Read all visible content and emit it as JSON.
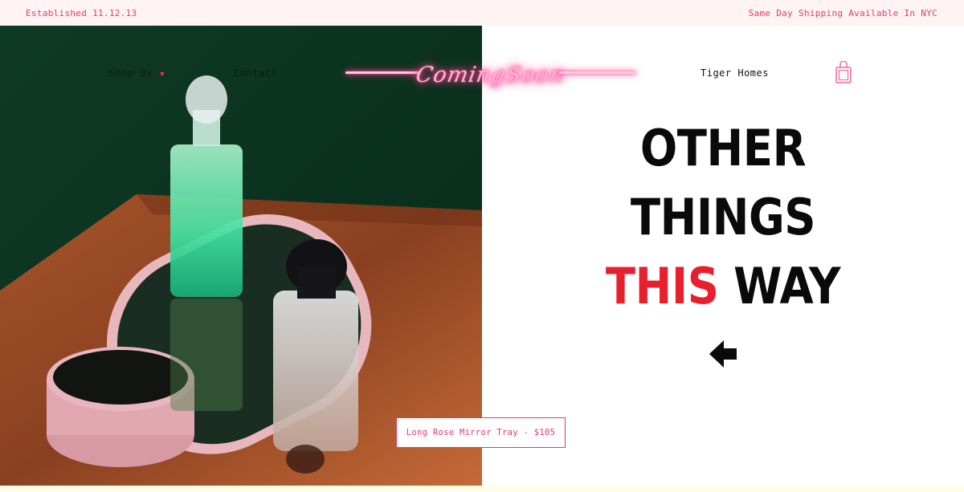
{
  "topbar": {
    "established": "Established 11.12.13",
    "shipping": "Same Day Shipping Available In NYC"
  },
  "nav": {
    "shop_by": "Shop By",
    "shop_caret_icon": "caret-down-icon",
    "contact": "Contact",
    "tiger_homes": "Tiger Homes",
    "bag_icon": "shopping-bag-icon"
  },
  "logo": {
    "text": "ComingSoon",
    "color": "#ff3e8f"
  },
  "hero": {
    "image": "perfume-bottles-on-pink-mirror-tray-photo"
  },
  "headline": {
    "line1": "OTHER",
    "line2": "THINGS",
    "line3_accent": "THIS",
    "line3_rest": "WAY",
    "accent_color": "#e8202e",
    "arrow_icon": "arrow-left-icon"
  },
  "product_tag": {
    "label": "Long Rose Mirror Tray - $105"
  },
  "colors": {
    "accent_pink": "#e8356a",
    "topbar_bg": "#fff3f3"
  }
}
